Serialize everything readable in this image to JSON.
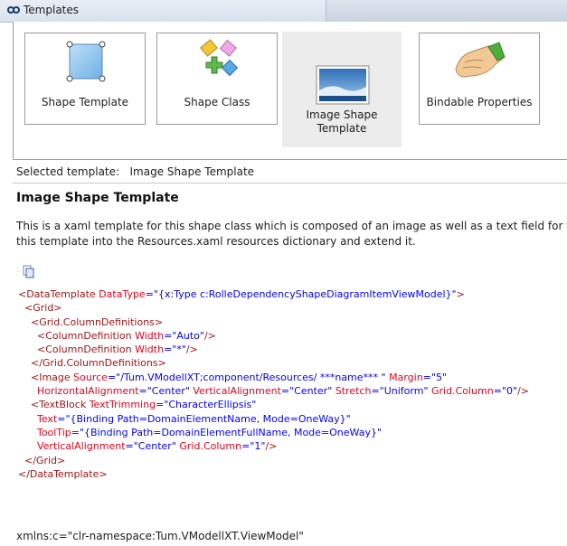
{
  "window": {
    "title": "Templates"
  },
  "gallery": {
    "tiles": [
      {
        "label": "Shape Template",
        "icon": "shape-template-icon"
      },
      {
        "label": "Shape Class",
        "icon": "shape-class-icon"
      },
      {
        "label_line1": "Image Shape",
        "label_line2": "Template",
        "icon": "image-shape-template-icon",
        "selected": true
      },
      {
        "label": "Bindable Properties",
        "icon": "bindable-properties-icon"
      }
    ]
  },
  "selected": {
    "prefix": "Selected template:",
    "value": "Image Shape Template"
  },
  "detail": {
    "heading": "Image Shape Template",
    "desc_line1": "This is a xaml template for this shape class which is composed of an image as well as a text field for the",
    "desc_line2": "this template into the Resources.xaml resources dictionary and extend it."
  },
  "code": {
    "l1": {
      "t1": "<DataTemplate ",
      "a1": "DataType",
      "v1": "=\"{x:Type c:RolleDependencyShapeDiagramItemViewModel}\"",
      "t2": ">"
    },
    "l2": "  <Grid>",
    "l3": "    <Grid.ColumnDefinitions>",
    "l4": {
      "t1": "      <ColumnDefinition ",
      "a1": "Width",
      "v1": "=\"Auto\"",
      "t2": "/>"
    },
    "l5": {
      "t1": "      <ColumnDefinition ",
      "a1": "Width",
      "v1": "=\"*\"",
      "t2": "/>"
    },
    "l6": "    </Grid.ColumnDefinitions>",
    "l7": {
      "t1": "    <Image ",
      "a1": "Source",
      "v1": "=\"/Tum.VModellXT;component/Resources/ ***name*** \"",
      "a2": " Margin",
      "v2": "=\"5\""
    },
    "l8": {
      "a1": "      HorizontalAlignment",
      "v1": "=\"Center\"",
      "a2": " VerticalAlignment",
      "v2": "=\"Center\"",
      "a3": " Stretch",
      "v3": "=\"Uniform\"",
      "a4": " Grid.Column",
      "v4": "=\"0\"",
      "t1": "/>"
    },
    "l9": {
      "t1": "    <TextBlock ",
      "a1": "TextTrimming",
      "v1": "=\"CharacterEllipsis\""
    },
    "l10": {
      "a1": "      Text",
      "v1": "=\"{Binding Path=DomainElementName, Mode=OneWay}\""
    },
    "l11": {
      "a1": "      ToolTip",
      "v1": "=\"{Binding Path=DomainElementFullName, Mode=OneWay}\""
    },
    "l12": {
      "a1": "      VerticalAlignment",
      "v1": "=\"Center\"",
      "a2": " Grid.Column",
      "v2": "=\"1\"",
      "t1": "/>"
    },
    "l13": "  </Grid>",
    "l14": "</DataTemplate>"
  },
  "namespace_line": "xmlns:c=\"clr-namespace:Tum.VModellXT.ViewModel\""
}
